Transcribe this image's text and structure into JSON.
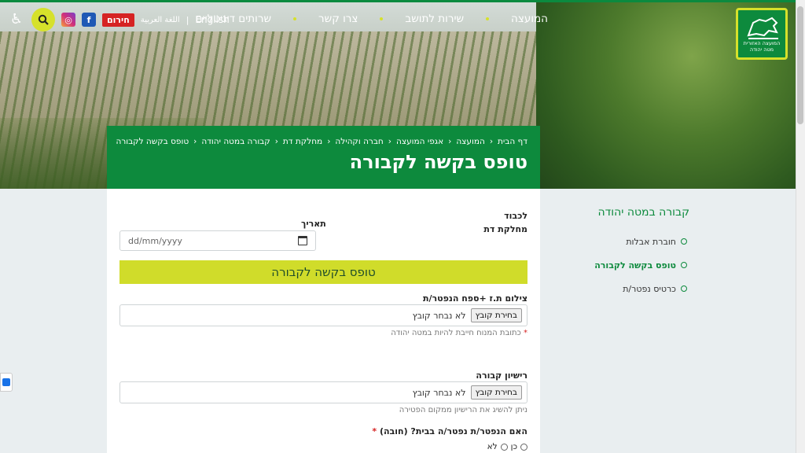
{
  "nav": {
    "menu": [
      "המועצה",
      "שירות לתושב",
      "צרו קשר",
      "שרותים דיגיטליים"
    ],
    "lang_en": "English",
    "lang_ar": "اللغة العربية",
    "emergency": "חירום",
    "logo_text": "המועצה האזורית מטה יהודה"
  },
  "title_box": {
    "breadcrumbs": [
      "דף הבית",
      "המועצה",
      "אגפי המועצה",
      "חברה וקהילה",
      "מחלקת דת",
      "קבורה במטה יהודה",
      "טופס בקשה לקבורה"
    ],
    "page_title": "טופס בקשה לקבורה"
  },
  "form": {
    "to_label": "לכבוד",
    "dept_label": "מחלקת דת",
    "date_label": "תאריך",
    "date_placeholder": "dd/mm/yyyy",
    "banner": "טופס בקשה לקבורה",
    "id_label": "צילום ת.ז +ספח הנפטר/ת",
    "file_button": "בחירת קובץ",
    "file_none": "לא נבחר קובץ",
    "address_note": "כתובת המנוח חייבת להיות במטה יהודה",
    "license_label": "רישיון קבורה",
    "license_note": "ניתן להשיג את הרישיון ממקום הפטירה",
    "died_home_label": "האם הנפטר/ת נפטר/ה בבית? (חובה)",
    "yes": "כן",
    "no": "לא"
  },
  "sidebar": {
    "title": "קבורה במטה יהודה",
    "items": [
      "חוברת אבלות",
      "טופס בקשה לקבורה",
      "כרטיס נפטר/ת"
    ]
  },
  "colors": {
    "brand_green": "#0d8a3d",
    "accent_lime": "#d6e12b",
    "banner_lime": "#d0dc2a",
    "emergency_red": "#d62323"
  }
}
